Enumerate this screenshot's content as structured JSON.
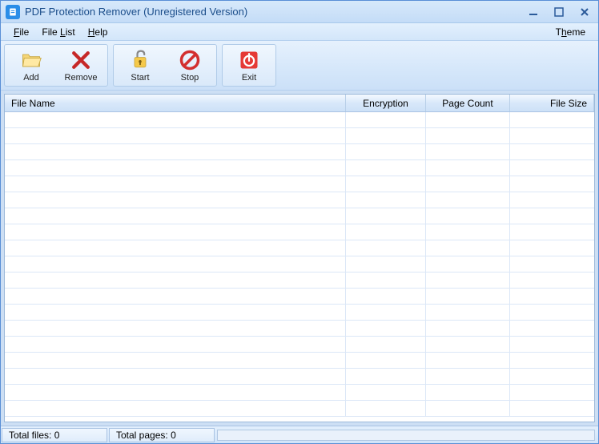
{
  "window": {
    "title": "PDF Protection Remover (Unregistered Version)"
  },
  "menu": {
    "file": "File",
    "file_list": "File List",
    "help": "Help",
    "theme": "Theme"
  },
  "toolbar": {
    "add": "Add",
    "remove": "Remove",
    "start": "Start",
    "stop": "Stop",
    "exit": "Exit"
  },
  "grid": {
    "columns": {
      "filename": "File Name",
      "encryption": "Encryption",
      "page_count": "Page Count",
      "file_size": "File Size"
    },
    "rows": []
  },
  "status": {
    "total_files_label": "Total files:",
    "total_files_value": "0",
    "total_pages_label": "Total pages:",
    "total_pages_value": "0",
    "progress_percent": 0
  }
}
